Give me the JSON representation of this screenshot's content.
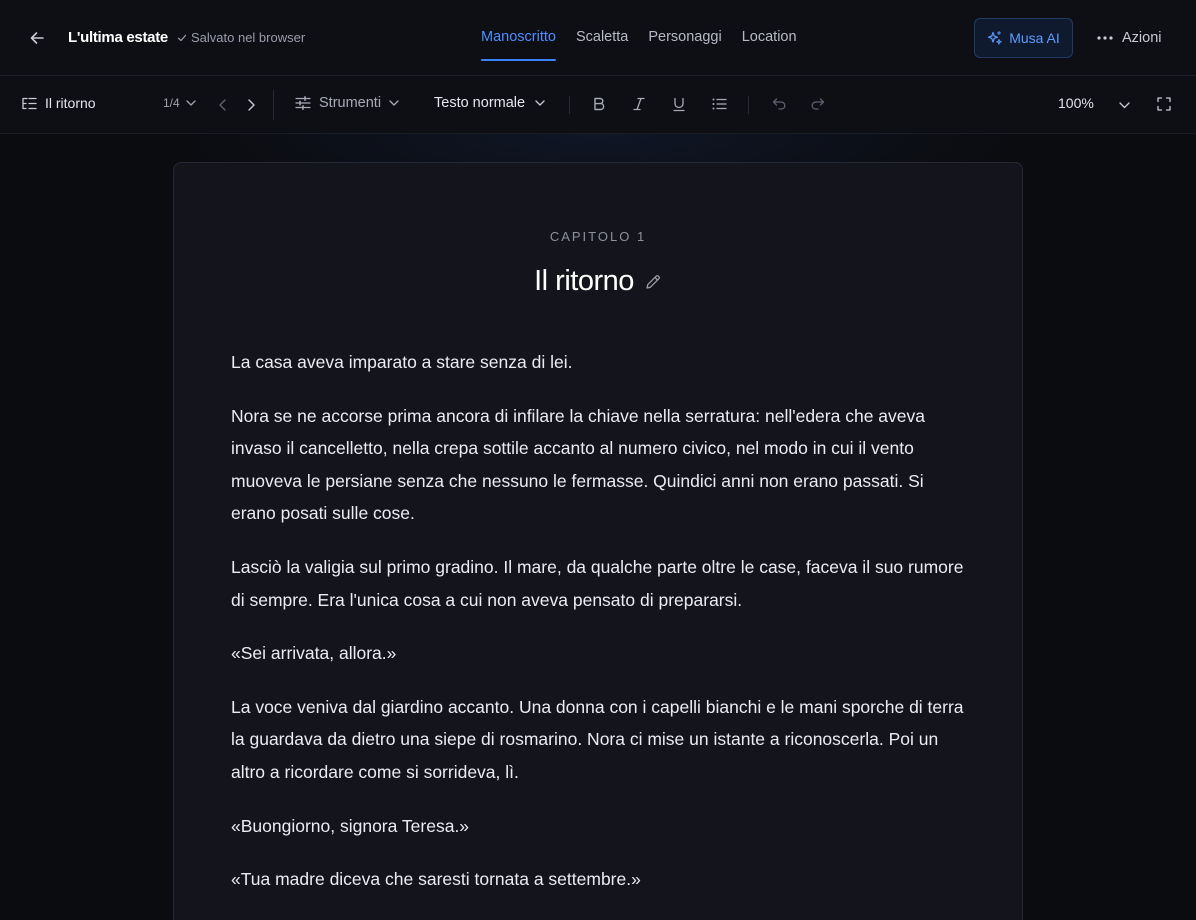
{
  "header": {
    "doc_title": "L'ultima estate",
    "saved_status": "Salvato nel browser",
    "tabs": [
      {
        "label": "Manoscritto",
        "active": true
      },
      {
        "label": "Scaletta",
        "active": false
      },
      {
        "label": "Personaggi",
        "active": false
      },
      {
        "label": "Location",
        "active": false
      }
    ],
    "musa_label": "Musa AI",
    "actions_label": "Azioni",
    "accent_color": "#3b82f6"
  },
  "toolbar": {
    "chapter_name": "Il ritorno",
    "page_indicator": "1/4",
    "tools_label": "Strumenti",
    "style_label": "Testo normale",
    "zoom": "100%"
  },
  "chapter": {
    "label": "CAPITOLO 1",
    "title": "Il ritorno",
    "paragraphs": [
      "La casa aveva imparato a stare senza di lei.",
      "Nora se ne accorse prima ancora di infilare la chiave nella serratura: nell'edera che aveva invaso il cancelletto, nella crepa sottile accanto al numero civico, nel modo in cui il vento muoveva le persiane senza che nessuno le fermasse. Quindici anni non erano passati. Si erano posati sulle cose.",
      "Lasciò la valigia sul primo gradino. Il mare, da qualche parte oltre le case, faceva il suo rumore di sempre. Era l'unica cosa a cui non aveva pensato di prepararsi.",
      "«Sei arrivata, allora.»",
      "La voce veniva dal giardino accanto. Una donna con i capelli bianchi e le mani sporche di terra la guardava da dietro una siepe di rosmarino. Nora ci mise un istante a riconoscerla. Poi un altro a ricordare come si sorrideva, lì.",
      "«Buongiorno, signora Teresa.»",
      "«Tua madre diceva che saresti tornata a settembre.»"
    ]
  }
}
